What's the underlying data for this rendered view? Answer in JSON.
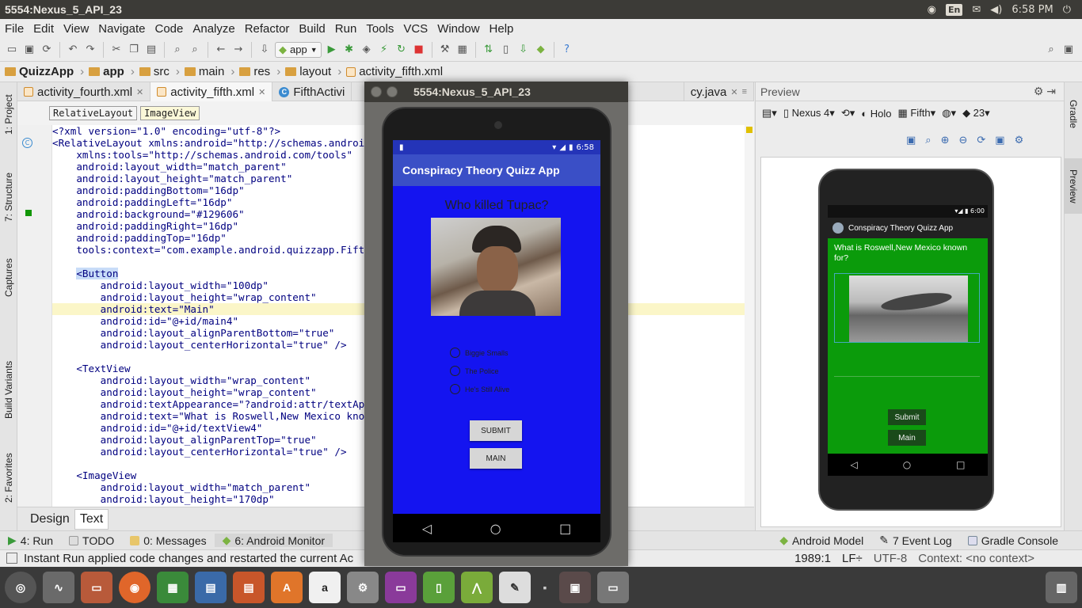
{
  "panel": {
    "title": "5554:Nexus_5_API_23",
    "keyboard": "En",
    "time": "6:58 PM"
  },
  "menu": [
    "File",
    "Edit",
    "View",
    "Navigate",
    "Code",
    "Analyze",
    "Refactor",
    "Build",
    "Run",
    "Tools",
    "VCS",
    "Window",
    "Help"
  ],
  "toolbar": {
    "run_config": "app"
  },
  "breadcrumb": [
    "QuizzApp",
    "app",
    "src",
    "main",
    "res",
    "layout",
    "activity_fifth.xml"
  ],
  "editor_tabs": [
    {
      "label": "activity_fourth.xml"
    },
    {
      "label": "activity_fifth.xml"
    },
    {
      "label": "FifthActivi"
    },
    {
      "label": "cy.java"
    }
  ],
  "component_path": [
    "RelativeLayout",
    "ImageView"
  ],
  "code_lines": [
    "<?xml version=\"1.0\" encoding=\"utf-8\"?>",
    "<RelativeLayout xmlns:android=\"http://schemas.android.com/apk/res/android\"",
    "    xmlns:tools=\"http://schemas.android.com/tools\"",
    "    android:layout_width=\"match_parent\"",
    "    android:layout_height=\"match_parent\"",
    "    android:paddingBottom=\"16dp\"",
    "    android:paddingLeft=\"16dp\"",
    "    android:background=\"#129606\"",
    "    android:paddingRight=\"16dp\"",
    "    android:paddingTop=\"16dp\"",
    "    tools:context=\"com.example.android.quizzapp.FifthActivity\">",
    "",
    "    <Button",
    "        android:layout_width=\"100dp\"",
    "        android:layout_height=\"wrap_content\"",
    "        android:text=\"Main\"",
    "        android:id=\"@+id/main4\"",
    "        android:layout_alignParentBottom=\"true\"",
    "        android:layout_centerHorizontal=\"true\" />",
    "",
    "    <TextView",
    "        android:layout_width=\"wrap_content\"",
    "        android:layout_height=\"wrap_content\"",
    "        android:textAppearance=\"?android:attr/textAppearanceMedium\"",
    "        android:text=\"What is Roswell,New Mexico known for?\"",
    "        android:id=\"@+id/textView4\"",
    "        android:layout_alignParentTop=\"true\"",
    "        android:layout_centerHorizontal=\"true\" />",
    "",
    "    <ImageView",
    "        android:layout_width=\"match_parent\"",
    "        android:layout_height=\"170dp\""
  ],
  "design_tabs": [
    "Design",
    "Text"
  ],
  "left_tools": [
    "1: Project",
    "7: Structure",
    "Captures",
    "Build Variants",
    "2: Favorites"
  ],
  "right_tools": [
    "Gradle",
    "Preview"
  ],
  "tool_windows": [
    "4: Run",
    "TODO",
    "0: Messages",
    "6: Android Monitor",
    "Android Model",
    "7 Event Log",
    "Gradle Console"
  ],
  "status": {
    "message": "Instant Run applied code changes and restarted the current Ac",
    "position": "1989:1",
    "line_sep": "LF÷",
    "encoding": "UTF-8",
    "context": "Context: <no context>"
  },
  "preview": {
    "title": "Preview",
    "device": "Nexus 4",
    "theme": "Holo",
    "activity": "Fifth",
    "api": "23",
    "phone": {
      "time": "6:00",
      "app_title": "Conspiracy Theory Quizz App",
      "question": "What is Roswell,New Mexico known for?",
      "submit": "Submit",
      "main": "Main"
    }
  },
  "emulator": {
    "title": "5554:Nexus_5_API_23",
    "time": "6:58",
    "app_title": "Conspiracy Theory Quizz App",
    "question": "Who killed Tupac?",
    "options": [
      "Biggie Smalls",
      "The Police",
      "He's Still Alive"
    ],
    "submit": "SUBMIT",
    "main": "MAIN"
  },
  "colors": {
    "emulator_bg": "#1414f0",
    "preview_bg": "#0b9b0b",
    "action_bar": "#3a4fc6"
  }
}
